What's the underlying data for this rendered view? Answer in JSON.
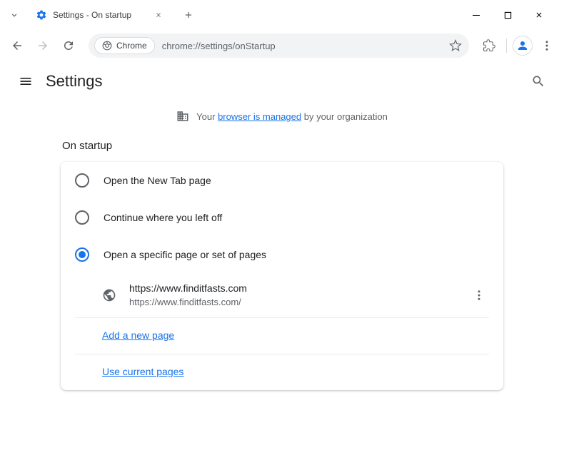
{
  "tab": {
    "title": "Settings - On startup"
  },
  "omnibox": {
    "chip_label": "Chrome",
    "url": "chrome://settings/onStartup"
  },
  "settings": {
    "title": "Settings",
    "managed_prefix": "Your ",
    "managed_link": "browser is managed",
    "managed_suffix": " by your organization",
    "section_title": "On startup",
    "options": {
      "new_tab": "Open the New Tab page",
      "continue": "Continue where you left off",
      "specific": "Open a specific page or set of pages"
    },
    "pages": [
      {
        "title": "https://www.finditfasts.com",
        "url": "https://www.finditfasts.com/"
      }
    ],
    "add_page": "Add a new page",
    "use_current": "Use current pages"
  }
}
